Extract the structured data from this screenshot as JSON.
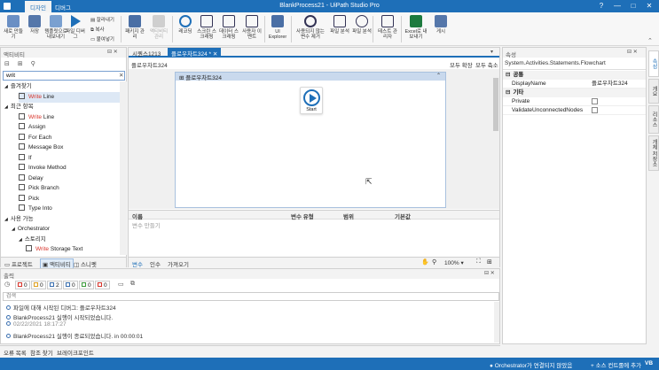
{
  "titlebar": {
    "tab_design": "디자인",
    "tab_debug": "디버그",
    "title": "BlankProcess21 - UiPath Studio Pro",
    "help": "?",
    "minimize": "—",
    "maximize": "□",
    "close": "✕"
  },
  "ribbon": {
    "new": "새로 만들기",
    "save": "저장",
    "export_template": "템플릿으로 내보내기",
    "run": "파일 디버그",
    "paste": "붙여넣기",
    "copy": "복사",
    "cut": "잘라내기",
    "package_mgr": "패키지 관리",
    "activate": "액티비티 관리",
    "record": "레코딩",
    "screen_scraping": "스크린 스크래핑",
    "data_scraping": "데이터 스크래핑",
    "user_events": "사용자 이벤트",
    "ui_explorer": "UI Explorer",
    "remove_unused": "사용되지 않는 변수 제거",
    "analyze_file": "파일 분석",
    "test": "테스트 관리자",
    "export_excel": "Excel로 내보내기",
    "publish": "게시"
  },
  "activities": {
    "header": "액티비티",
    "search_value": "writ",
    "tree": [
      {
        "label": "즐겨찾기",
        "level": 0,
        "expanded": true
      },
      {
        "label": "Write Line",
        "level": 2,
        "highlight": "Write",
        "selected": true
      },
      {
        "label": "최근 항목",
        "level": 0,
        "expanded": true
      },
      {
        "label": "Write Line",
        "level": 2,
        "highlight": "Write"
      },
      {
        "label": "Assign",
        "level": 2
      },
      {
        "label": "For Each",
        "level": 2
      },
      {
        "label": "Message Box",
        "level": 2
      },
      {
        "label": "If",
        "level": 2
      },
      {
        "label": "Invoke Method",
        "level": 2
      },
      {
        "label": "Delay",
        "level": 2
      },
      {
        "label": "Pick Branch",
        "level": 2
      },
      {
        "label": "Pick",
        "level": 2
      },
      {
        "label": "Type Into",
        "level": 2
      },
      {
        "label": "사용 가능",
        "level": 0,
        "expanded": true
      },
      {
        "label": "Orchestrator",
        "level": 1,
        "expanded": true
      },
      {
        "label": "스토리지",
        "level": 2,
        "expanded": true
      },
      {
        "label": "Write Storage Text",
        "level": 3,
        "highlight": "Write"
      }
    ],
    "bottom_tabs": [
      "프로젝트",
      "액티비티",
      "스니펫"
    ]
  },
  "designer": {
    "tabs": [
      {
        "label": "시퀀스1213",
        "active": false
      },
      {
        "label": "플로우차트324 *",
        "active": true
      }
    ],
    "breadcrumb": "플로우차트324",
    "expand_all": "모두 확장",
    "collapse_all": "모두 축소",
    "flowchart_title": "플로우차트324",
    "start_label": "Start",
    "variables_headers": [
      "이름",
      "변수 유형",
      "범위",
      "기본값"
    ],
    "create_variable": "변수 만들기",
    "bottom_tabs": [
      "변수",
      "인수",
      "가져오기"
    ],
    "zoom": "100%"
  },
  "properties": {
    "header": "속성",
    "type": "System.Activities.Statements.Flowchart",
    "sections": [
      {
        "title": "공통",
        "rows": [
          {
            "name": "DisplayName",
            "value": "플로우차트324"
          }
        ]
      },
      {
        "title": "기타",
        "rows": [
          {
            "name": "Private",
            "value": ""
          },
          {
            "name": "ValidateUnconnectedNodes",
            "value": ""
          }
        ]
      }
    ],
    "side_tabs": [
      "속성",
      "개요",
      "리소스",
      "개체 저장소"
    ]
  },
  "output": {
    "header": "출력",
    "filters": [
      {
        "count": "0",
        "color": "#d9342b"
      },
      {
        "count": "0",
        "color": "#e0a020"
      },
      {
        "count": "2",
        "color": "#3a6fb0"
      },
      {
        "count": "0",
        "color": "#3a6fb0"
      },
      {
        "count": "0",
        "color": "#3a9a3a"
      },
      {
        "count": "0",
        "color": "#d9342b"
      }
    ],
    "search_placeholder": "검색",
    "lines": [
      "파일에 대해 시작된 디버그: 플로우차트324",
      "BlankProcess21 실행이 시작되었습니다.",
      "02/22/2021 18:17:27",
      "BlankProcess21 실행이 종료되었습니다. in 00:00:01"
    ],
    "bottom_tabs": [
      "오류 목록",
      "참조 찾기",
      "브레이크포인트"
    ]
  },
  "statusbar": {
    "orchestrator": "Orchestrator가 연결되지 않았음",
    "source_control": "+ 소스 컨트롤에 추가",
    "vb": "VB"
  },
  "colors": {
    "accent": "#1e6fb8",
    "highlight": "#d9342b"
  }
}
